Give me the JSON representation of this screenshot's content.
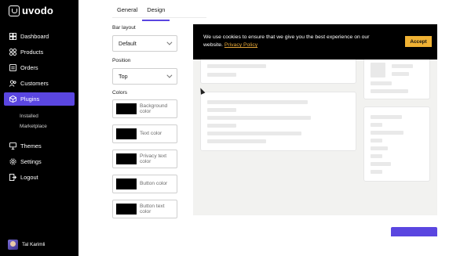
{
  "app": {
    "name": "uvodo"
  },
  "sidebar": {
    "items": [
      {
        "label": "Dashboard",
        "icon": "dashboard-icon"
      },
      {
        "label": "Products",
        "icon": "products-icon"
      },
      {
        "label": "Orders",
        "icon": "orders-icon"
      },
      {
        "label": "Customers",
        "icon": "customers-icon"
      },
      {
        "label": "Plugins",
        "icon": "plugins-icon",
        "active": true
      }
    ],
    "sub_items": [
      {
        "label": "Installed"
      },
      {
        "label": "Marketplace"
      }
    ],
    "bottom_items": [
      {
        "label": "Themes",
        "icon": "themes-icon"
      },
      {
        "label": "Settings",
        "icon": "settings-icon"
      },
      {
        "label": "Logout",
        "icon": "logout-icon"
      }
    ],
    "user": {
      "name": "Tal Karimli"
    }
  },
  "tabs": [
    {
      "label": "General"
    },
    {
      "label": "Design",
      "active": true
    }
  ],
  "settings": {
    "bar_layout": {
      "label": "Bar layout",
      "value": "Default"
    },
    "position": {
      "label": "Position",
      "value": "Top"
    },
    "colors": {
      "label": "Colors",
      "fields": [
        {
          "label": "Background color",
          "value": "#000000"
        },
        {
          "label": "Text color",
          "value": "#000000"
        },
        {
          "label": "Privacy text color",
          "value": "#000000"
        },
        {
          "label": "Button color",
          "value": "#000000"
        },
        {
          "label": "Button text color",
          "value": "#000000"
        }
      ]
    }
  },
  "cookie_bar": {
    "message": "We use cookies to ensure that we give you the best experience on our website.",
    "privacy_link": "Privacy Policy",
    "accept_label": "Accept"
  },
  "colors": {
    "accent": "#5a46e0",
    "cookie_button": "#f0b234",
    "sidebar_bg": "#000000"
  }
}
